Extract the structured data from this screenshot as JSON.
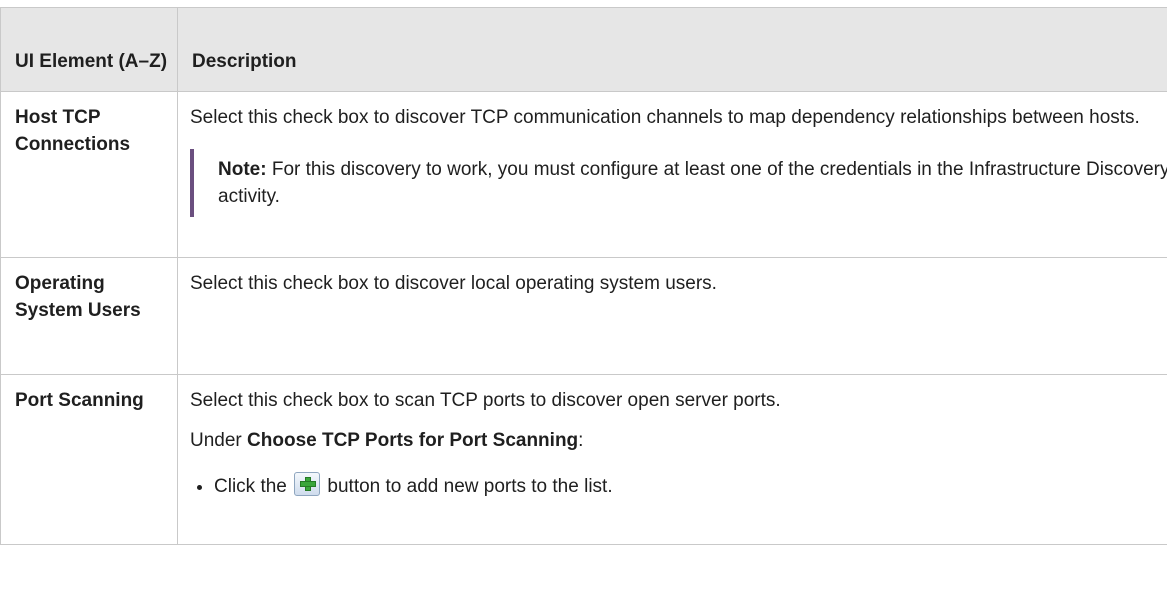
{
  "header": {
    "col1": "UI Element (A–Z)",
    "col2": "Description"
  },
  "rows": [
    {
      "element": "Host TCP Connections",
      "description": "Select this check box to discover TCP communication channels to map dependency relationships between hosts.",
      "note_label": "Note:",
      "note_text": " For this discovery to work, you must configure at least one of the credentials in the Infrastructure Discovery activity."
    },
    {
      "element": "Operating System Users",
      "description": "Select this check box to discover local operating system users."
    },
    {
      "element": "Port Scanning",
      "description": "Select this check box to scan TCP ports to discover open server ports.",
      "under_prefix": "Under ",
      "under_bold": "Choose TCP Ports for Port Scanning",
      "under_suffix": ":",
      "bullet_prefix": "Click the ",
      "bullet_icon": "add-plus-icon",
      "bullet_suffix": " button to add new ports to the list."
    }
  ]
}
